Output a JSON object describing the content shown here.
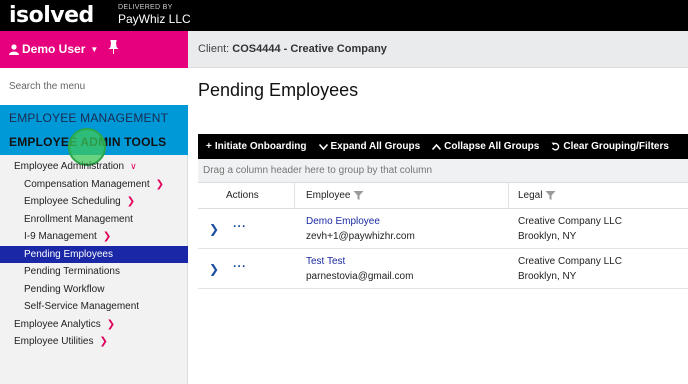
{
  "topbar": {
    "logo": "isolved",
    "delivered_by": "DELIVERED BY",
    "partner": "PayWhiz LLC"
  },
  "user": {
    "name": "Demo User",
    "pin_icon": "pin-icon"
  },
  "client": {
    "label": "Client:",
    "value": "COS4444 - Creative Company"
  },
  "sidebar": {
    "search_placeholder": "Search the menu",
    "heading1": "EMPLOYEE MANAGEMENT",
    "heading2": "EMPLOYEE ADMIN TOOLS",
    "items": [
      {
        "label": "Employee Administration",
        "level": 1,
        "chevron": "down"
      },
      {
        "label": "Compensation Management",
        "level": 2,
        "chevron": "right"
      },
      {
        "label": "Employee Scheduling",
        "level": 2,
        "chevron": "right"
      },
      {
        "label": "Enrollment Management",
        "level": 2,
        "chevron": ""
      },
      {
        "label": "I-9 Management",
        "level": 2,
        "chevron": "right"
      },
      {
        "label": "Pending Employees",
        "level": 2,
        "chevron": "",
        "active": true
      },
      {
        "label": "Pending Terminations",
        "level": 2,
        "chevron": ""
      },
      {
        "label": "Pending Workflow",
        "level": 2,
        "chevron": ""
      },
      {
        "label": "Self-Service Management",
        "level": 2,
        "chevron": ""
      },
      {
        "label": "Employee Analytics",
        "level": 1,
        "chevron": "right"
      },
      {
        "label": "Employee Utilities",
        "level": 1,
        "chevron": "right"
      }
    ]
  },
  "main": {
    "title": "Pending Employees",
    "toolbar": {
      "initiate": "Initiate Onboarding",
      "expand": "Expand All Groups",
      "collapse": "Collapse All Groups",
      "clear": "Clear Grouping/Filters"
    },
    "group_hint": "Drag a column header here to group by that column",
    "columns": {
      "actions": "Actions",
      "employee": "Employee",
      "legal": "Legal"
    },
    "rows": [
      {
        "name": "Demo Employee",
        "email": "zevh+1@paywhizhr.com",
        "company": "Creative Company LLC",
        "location": "Brooklyn, NY"
      },
      {
        "name": "Test Test",
        "email": "parnestovia@gmail.com",
        "company": "Creative Company LLC",
        "location": "Brooklyn, NY"
      }
    ]
  },
  "colors": {
    "accent_pink": "#e6007e",
    "menu_blue": "#0099d8",
    "active_blue": "#1a27a6",
    "toolbar_black": "#000000"
  }
}
